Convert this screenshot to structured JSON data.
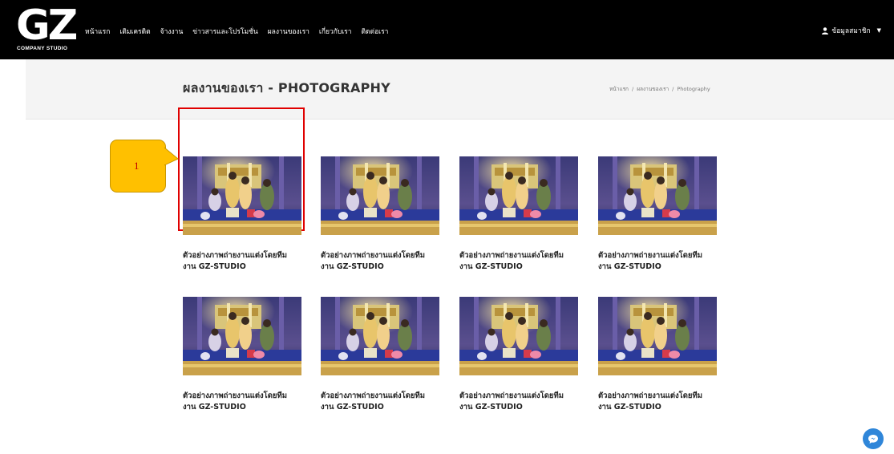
{
  "brand": {
    "logo_text": "GZ",
    "logo_sub": "COMPANY STUDIO"
  },
  "nav": {
    "items": [
      {
        "label": "หน้าแรก"
      },
      {
        "label": "เติมเครดิต"
      },
      {
        "label": "จ้างงาน"
      },
      {
        "label": "ข่าวสารและโปรโมชั่น"
      },
      {
        "label": "ผลงานของเรา"
      },
      {
        "label": "เกี่ยวกับเรา"
      },
      {
        "label": "ติดต่อเรา"
      }
    ],
    "member_label": "ข้อมูลสมาชิก"
  },
  "page": {
    "title": "ผลงานของเรา - PHOTOGRAPHY",
    "breadcrumb": [
      "หน้าแรก",
      "ผลงานของเรา",
      "Photography"
    ],
    "breadcrumb_sep": "/"
  },
  "annotation": {
    "number": "1",
    "callout_color": "#ffc000",
    "highlight_color": "#e00000"
  },
  "gallery": {
    "items": [
      {
        "caption_line1": "ตัวอย่างภาพถ่ายงานแต่งโดยทีม",
        "caption_line2": "งาน GZ-STUDIO"
      },
      {
        "caption_line1": "ตัวอย่างภาพถ่ายงานแต่งโดยทีม",
        "caption_line2": "งาน GZ-STUDIO"
      },
      {
        "caption_line1": "ตัวอย่างภาพถ่ายงานแต่งโดยทีม",
        "caption_line2": "งาน GZ-STUDIO"
      },
      {
        "caption_line1": "ตัวอย่างภาพถ่ายงานแต่งโดยทีม",
        "caption_line2": "งาน GZ-STUDIO"
      },
      {
        "caption_line1": "ตัวอย่างภาพถ่ายงานแต่งโดยทีม",
        "caption_line2": "งาน GZ-STUDIO"
      },
      {
        "caption_line1": "ตัวอย่างภาพถ่ายงานแต่งโดยทีม",
        "caption_line2": "งาน GZ-STUDIO"
      },
      {
        "caption_line1": "ตัวอย่างภาพถ่ายงานแต่งโดยทีม",
        "caption_line2": "งาน GZ-STUDIO"
      },
      {
        "caption_line1": "ตัวอย่างภาพถ่ายงานแต่งโดยทีม",
        "caption_line2": "งาน GZ-STUDIO"
      }
    ]
  },
  "icons": {
    "member": "user-icon",
    "member_caret": "caret-down-icon",
    "chat": "chat-bubble-icon"
  },
  "colors": {
    "topbar": "#000000",
    "band": "#f4f4f4",
    "chat": "#2f86d9"
  }
}
